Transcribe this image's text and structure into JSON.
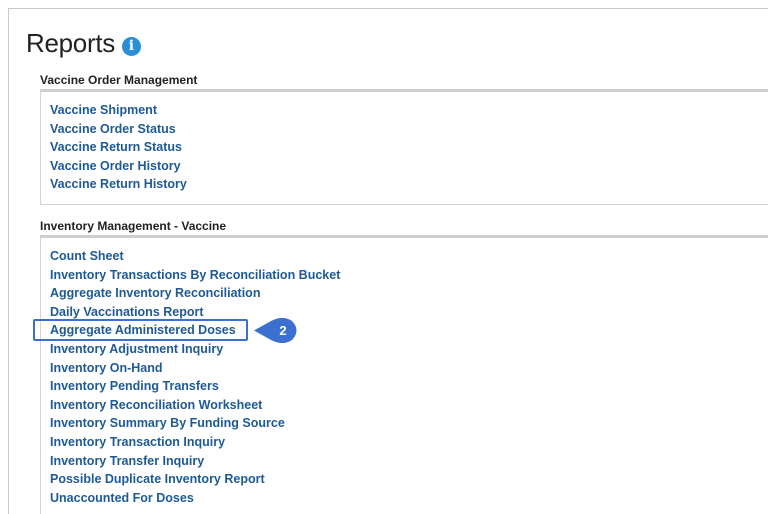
{
  "page": {
    "title": "Reports",
    "info_icon": "info-icon"
  },
  "sections": [
    {
      "header": "Vaccine Order Management",
      "links": [
        "Vaccine Shipment",
        "Vaccine Order Status",
        "Vaccine Return Status",
        "Vaccine Order History",
        "Vaccine Return History"
      ]
    },
    {
      "header": "Inventory Management - Vaccine",
      "links": [
        "Count Sheet",
        "Inventory Transactions By Reconciliation Bucket",
        "Aggregate Inventory Reconciliation",
        "Daily Vaccinations Report",
        "Aggregate Administered Doses",
        "Inventory Adjustment Inquiry",
        "Inventory On-Hand",
        "Inventory Pending Transfers",
        "Inventory Reconciliation Worksheet",
        "Inventory Summary By Funding Source",
        "Inventory Transaction Inquiry",
        "Inventory Transfer Inquiry",
        "Possible Duplicate Inventory Report",
        "Unaccounted For Doses"
      ]
    }
  ],
  "callout": {
    "step_number": "2",
    "target": "Aggregate Administered Doses",
    "color": "#3b6fd0"
  },
  "colors": {
    "link": "#1e5a96",
    "info_icon": "#2b8fd6"
  }
}
